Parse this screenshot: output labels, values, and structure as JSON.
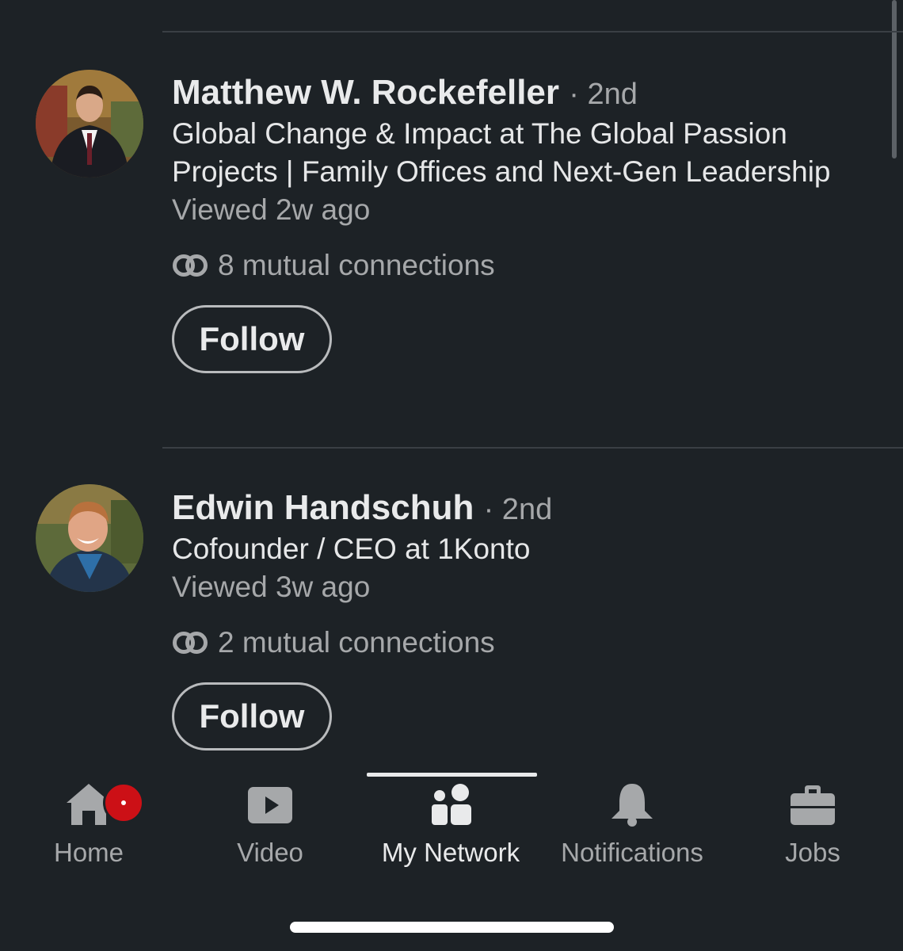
{
  "people": [
    {
      "name": "Matthew W. Rockefeller",
      "degree": "· 2nd",
      "headline": "Global Change & Impact at The Global Passion Projects | Family Offices and Next-Gen Leadership",
      "viewed": "Viewed 2w ago",
      "mutual": "8 mutual connections",
      "follow_label": "Follow"
    },
    {
      "name": "Edwin Handschuh",
      "degree": "· 2nd",
      "headline": "Cofounder / CEO at 1Konto",
      "viewed": "Viewed 3w ago",
      "mutual": "2 mutual connections",
      "follow_label": "Follow"
    }
  ],
  "tabbar": {
    "items": [
      {
        "label": "Home",
        "icon": "home-icon",
        "has_badge": true
      },
      {
        "label": "Video",
        "icon": "video-icon"
      },
      {
        "label": "My Network",
        "icon": "network-icon",
        "active": true
      },
      {
        "label": "Notifications",
        "icon": "bell-icon"
      },
      {
        "label": "Jobs",
        "icon": "briefcase-icon"
      }
    ]
  },
  "colors": {
    "background": "#1d2226",
    "badge": "#cc1016",
    "muted_text": "#a6a8aa",
    "primary_text": "#e9eaeb"
  }
}
